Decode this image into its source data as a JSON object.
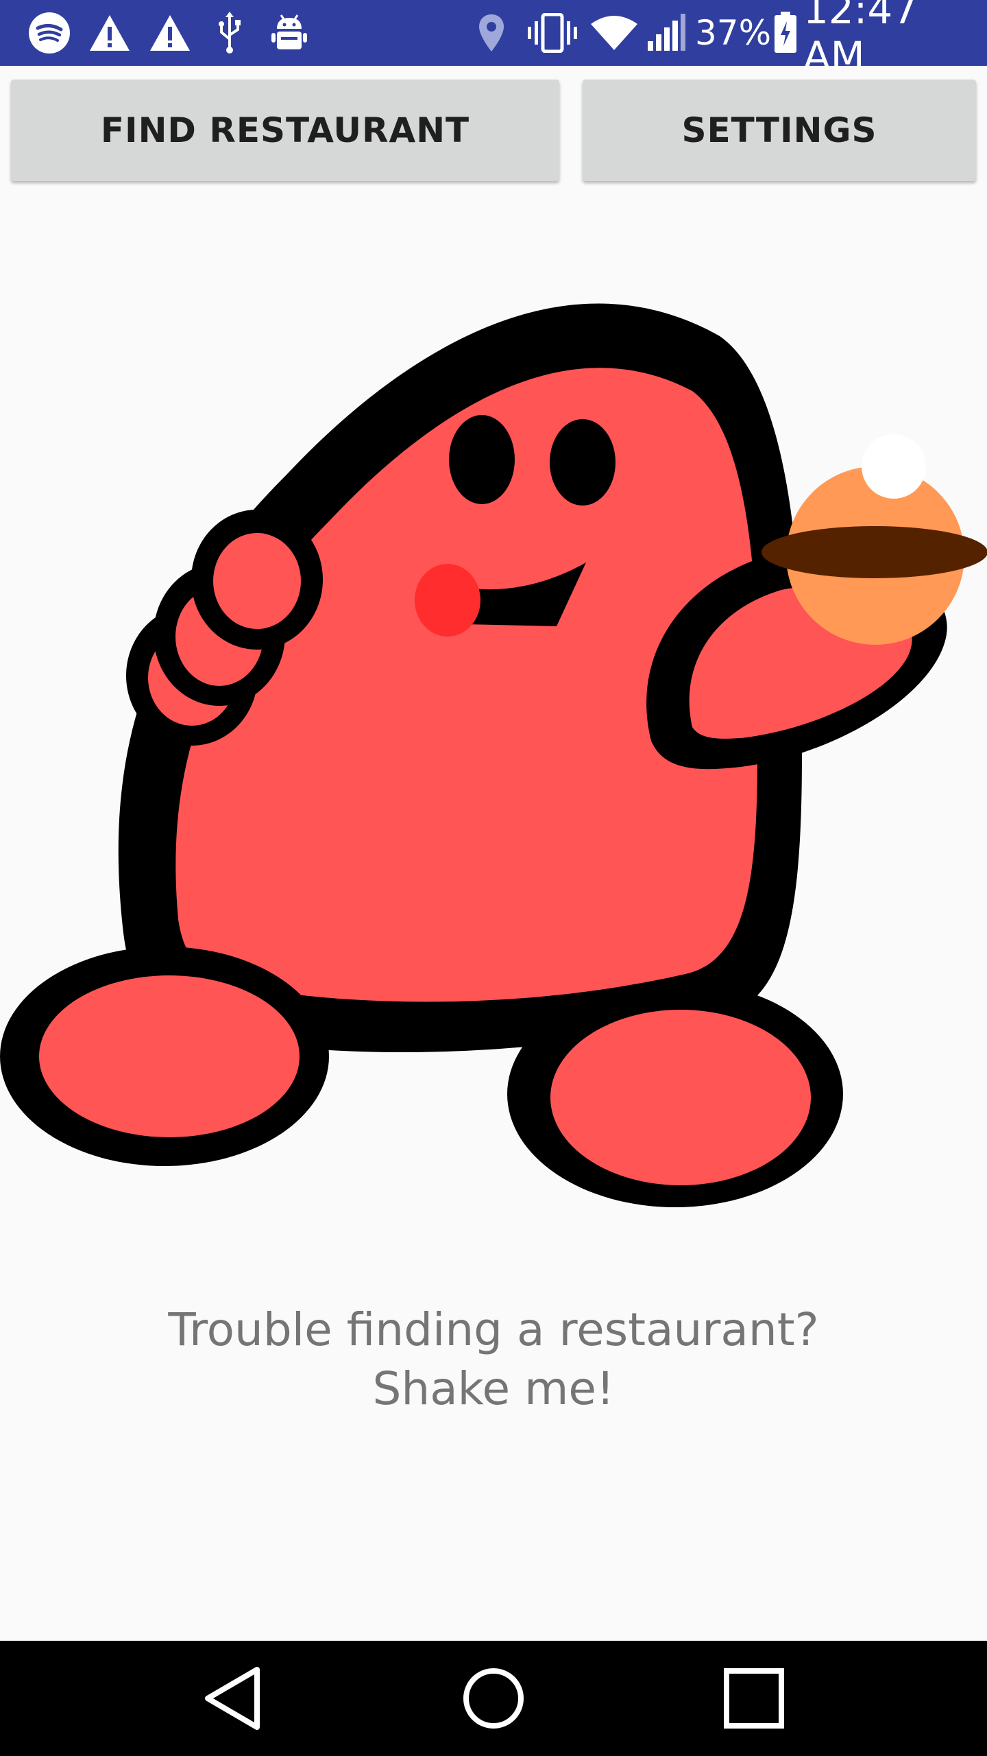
{
  "status_bar": {
    "battery_percent": "37%",
    "time": "12:47 AM",
    "left_icons": [
      "spotify-icon",
      "warning-icon",
      "warning-icon",
      "usb-icon",
      "android-debug-icon"
    ],
    "right_icons": [
      "location-icon",
      "vibrate-icon",
      "wifi-icon",
      "cell-signal-icon",
      "battery-charging-icon"
    ],
    "background_color": "#303f9f"
  },
  "toolbar": {
    "find_restaurant_label": "FIND RESTAURANT",
    "settings_label": "SETTINGS"
  },
  "mascot": {
    "description_icon": "red-blob-mascot-holding-food",
    "colors": {
      "body": "#ff5555",
      "outline": "#000000",
      "tongue": "#ff2d2d",
      "food": "#ff9955",
      "food_band": "#552200"
    }
  },
  "caption": {
    "line1": "Trouble finding a restaurant?",
    "line2": "Shake me!"
  },
  "nav_bar": {
    "icons": [
      "back-icon",
      "home-icon",
      "recents-icon"
    ]
  }
}
